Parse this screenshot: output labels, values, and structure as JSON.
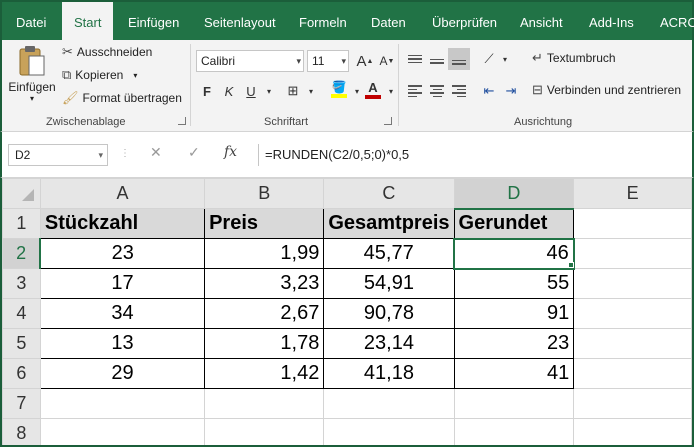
{
  "tabs": [
    "Datei",
    "Start",
    "Einfügen",
    "Seitenlayout",
    "Formeln",
    "Daten",
    "Überprüfen",
    "Ansicht",
    "Add-Ins",
    "ACRO"
  ],
  "ribbon": {
    "clipboard": {
      "paste_label": "Einfügen",
      "cut_label": "Ausschneiden",
      "copy_label": "Kopieren",
      "format_painter_label": "Format übertragen",
      "group_label": "Zwischenablage"
    },
    "font": {
      "font_name": "Calibri",
      "font_size": "11",
      "bold": "F",
      "italic": "K",
      "underline": "U",
      "group_label": "Schriftart",
      "fill_color": "#ffff00",
      "font_color": "#c00000"
    },
    "alignment": {
      "wrap_label": "Textumbruch",
      "merge_label": "Verbinden und zentrieren",
      "group_label": "Ausrichtung"
    }
  },
  "formula_bar": {
    "name_box": "D2",
    "cancel_icon": "✕",
    "enter_icon": "✓",
    "fx_label": "fx",
    "formula": "=RUNDEN(C2/0,5;0)*0,5"
  },
  "sheet": {
    "columns": [
      "A",
      "B",
      "C",
      "D",
      "E"
    ],
    "rows": [
      "1",
      "2",
      "3",
      "4",
      "5",
      "6",
      "7",
      "8"
    ],
    "header": [
      "Stückzahl",
      "Preis",
      "Gesamtpreis",
      "Gerundet"
    ],
    "data": [
      [
        "23",
        "1,99",
        "45,77",
        "46"
      ],
      [
        "17",
        "3,23",
        "54,91",
        "55"
      ],
      [
        "34",
        "2,67",
        "90,78",
        "91"
      ],
      [
        "13",
        "1,78",
        "23,14",
        "23"
      ],
      [
        "29",
        "1,42",
        "41,18",
        "41"
      ]
    ],
    "active_cell": "D2"
  }
}
